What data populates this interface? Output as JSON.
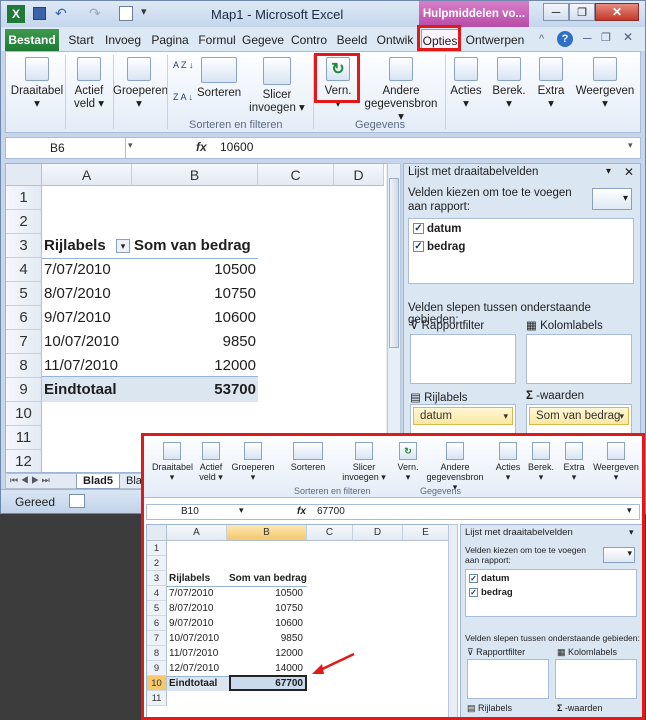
{
  "titlebar": {
    "title": "Map1 - Microsoft Excel",
    "context_tab": "Hulpmiddelen vo..."
  },
  "tabs": [
    "Bestand",
    "Start",
    "Invoeg",
    "Pagina",
    "Formul",
    "Gegeve",
    "Contro",
    "Beeld",
    "Ontwik",
    "Opties",
    "Ontwerpen"
  ],
  "ribbon": {
    "draaitabel": "Draaitabel",
    "actief_veld_1": "Actief",
    "actief_veld_2": "veld",
    "groeperen": "Groeperen",
    "sorteren": "Sorteren",
    "slicer_1": "Slicer",
    "slicer_2": "invoegen",
    "vern": "Vern.",
    "andere_1": "Andere",
    "andere_2": "gegevensbron",
    "acties": "Acties",
    "berek": "Berek.",
    "extra": "Extra",
    "weergeven": "Weergeven",
    "group_sort": "Sorteren en filteren",
    "group_data": "Gegevens",
    "az": "A Z",
    "za": "Z A"
  },
  "formula": {
    "name_box": "B6",
    "fx": "fx",
    "value": "10600"
  },
  "grid": {
    "cols": [
      "A",
      "B",
      "C",
      "D"
    ],
    "rows": [
      "1",
      "2",
      "3",
      "4",
      "5",
      "6",
      "7",
      "8",
      "9",
      "10",
      "11",
      "12"
    ],
    "header_a": "Rijlabels",
    "header_b": "Som van bedrag",
    "data": [
      [
        "7/07/2010",
        "10500"
      ],
      [
        "8/07/2010",
        "10750"
      ],
      [
        "9/07/2010",
        "10600"
      ],
      [
        "10/07/2010",
        "9850"
      ],
      [
        "11/07/2010",
        "12000"
      ]
    ],
    "total_label": "Eindtotaal",
    "total_value": "53700"
  },
  "sheets": {
    "active": "Blad5",
    "next": "Bla"
  },
  "status": {
    "text": "Gereed"
  },
  "pane": {
    "title": "Lijst met draaitabelvelden",
    "choose": "Velden kiezen om toe te voegen aan rapport:",
    "fields": [
      "datum",
      "bedrag"
    ],
    "drag": "Velden slepen tussen onderstaande gebieden:",
    "rapportfilter": "Rapportfilter",
    "kolomlabels": "Kolomlabels",
    "rijlabels": "Rijlabels",
    "waarden": "-waarden",
    "row_chip": "datum",
    "value_chip": "Som van bedrag"
  },
  "inset": {
    "formula": {
      "name_box": "B10",
      "fx": "fx",
      "value": "67700"
    },
    "cols": [
      "A",
      "B",
      "C",
      "D",
      "E"
    ],
    "rows": [
      "1",
      "2",
      "3",
      "4",
      "5",
      "6",
      "7",
      "8",
      "9",
      "10",
      "11"
    ],
    "header_a": "Rijlabels",
    "header_b": "Som van bedrag",
    "data": [
      [
        "7/07/2010",
        "10500"
      ],
      [
        "8/07/2010",
        "10750"
      ],
      [
        "9/07/2010",
        "10600"
      ],
      [
        "10/07/2010",
        "9850"
      ],
      [
        "11/07/2010",
        "12000"
      ],
      [
        "12/07/2010",
        "14000"
      ]
    ],
    "total_label": "Eindtotaal",
    "total_value": "67700",
    "pane_title": "Lijst met draaitabelvelden",
    "choose": "Velden kiezen om toe te voegen aan rapport:",
    "fields": [
      "datum",
      "bedrag"
    ],
    "drag": "Velden slepen tussen onderstaande gebieden:",
    "rapportfilter": "Rapportfilter",
    "kolomlabels": "Kolomlabels",
    "rijlabels": "Rijlabels",
    "waarden": "-waarden"
  },
  "colors": {
    "highlight_red": "#e01a1a",
    "accent_green": "#1f8a3a",
    "context_tab": "#b84ba6"
  }
}
